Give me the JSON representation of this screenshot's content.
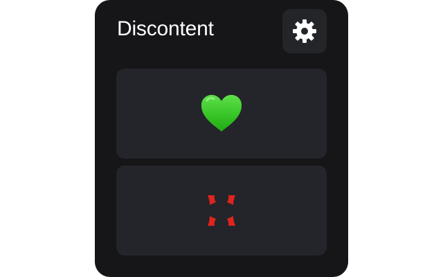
{
  "app": {
    "title": "Discontent"
  },
  "header": {
    "settings_icon": "gear-icon"
  },
  "reactions": [
    {
      "name": "like",
      "icon": "green-heart-icon",
      "color": "#39c42b"
    },
    {
      "name": "dislike",
      "icon": "anger-symbol-icon",
      "color": "#e0241d"
    }
  ],
  "colors": {
    "panel_background": "#161619",
    "card_background": "#23252a",
    "title_text": "#ffffff",
    "gear": "#ffffff"
  }
}
